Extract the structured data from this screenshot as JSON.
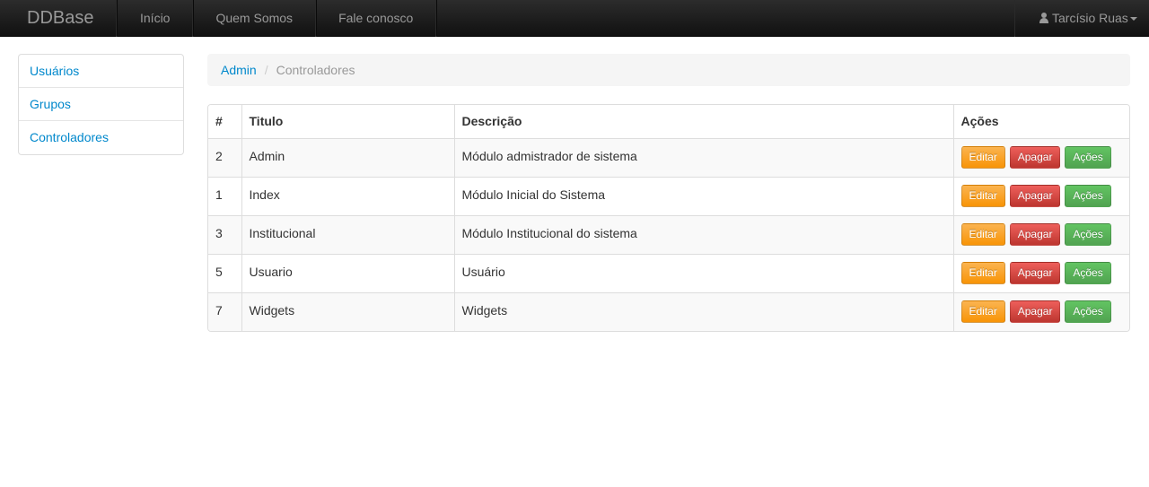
{
  "navbar": {
    "brand": "DDBase",
    "items": [
      "Início",
      "Quem Somos",
      "Fale conosco"
    ],
    "user": "Tarcísio Ruas"
  },
  "sidebar": {
    "items": [
      "Usuários",
      "Grupos",
      "Controladores"
    ]
  },
  "breadcrumb": {
    "root": "Admin",
    "separator": "/",
    "current": "Controladores"
  },
  "table": {
    "headers": [
      "#",
      "Titulo",
      "Descrição",
      "Ações"
    ],
    "rows": [
      {
        "id": "2",
        "titulo": "Admin",
        "descricao": "Módulo admistrador de sistema"
      },
      {
        "id": "1",
        "titulo": "Index",
        "descricao": "Módulo Inicial do Sistema"
      },
      {
        "id": "3",
        "titulo": "Institucional",
        "descricao": "Módulo Institucional do sistema"
      },
      {
        "id": "5",
        "titulo": "Usuario",
        "descricao": "Usuário"
      },
      {
        "id": "7",
        "titulo": "Widgets",
        "descricao": "Widgets"
      }
    ],
    "actions": {
      "edit": "Editar",
      "delete": "Apagar",
      "actions": "Ações"
    }
  },
  "colors": {
    "navbar": "#1b1b1b",
    "link": "#0088cc",
    "warning": "#f89406",
    "danger": "#bd362f",
    "success": "#51a351"
  },
  "icons": {
    "user": "user-icon",
    "caret": "caret-down-icon"
  }
}
